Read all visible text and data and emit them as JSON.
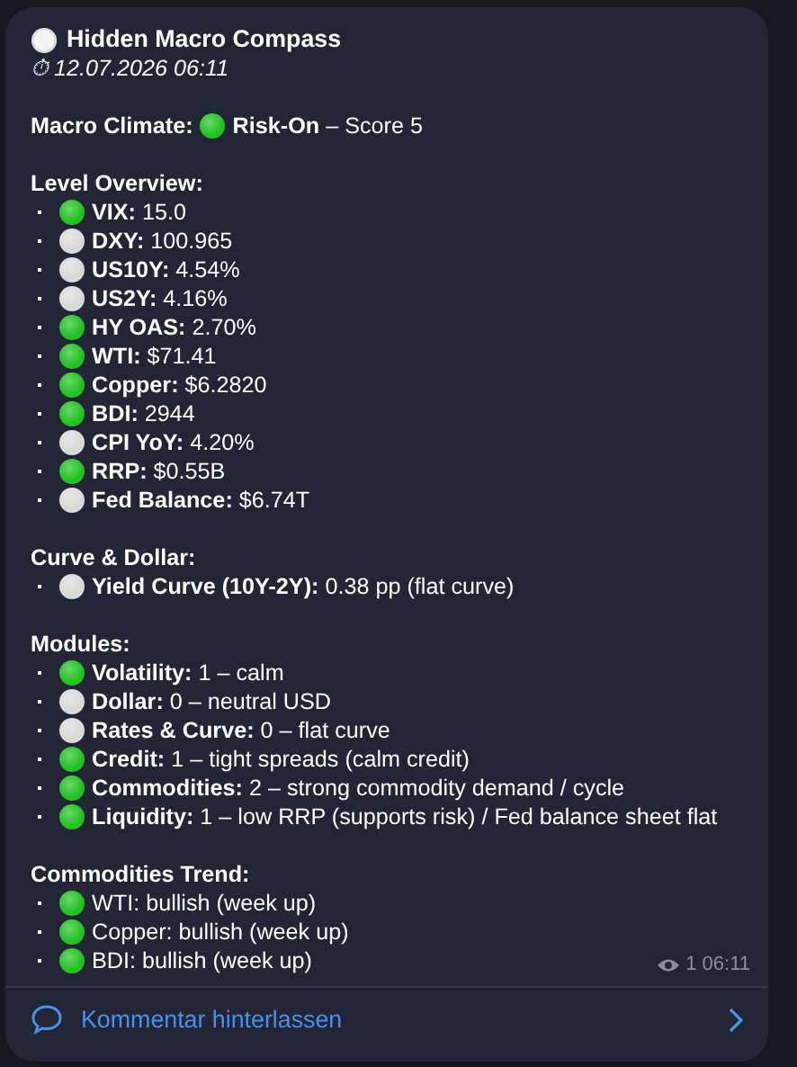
{
  "message": {
    "title": "Hidden Macro Compass",
    "timestamp_icon": "⏱",
    "timestamp": "12.07.2026 06:11",
    "climate": {
      "label": "Macro Climate:",
      "color": "#1fc21f",
      "status": "Risk-On",
      "score": "– Score 5"
    },
    "sections": [
      {
        "heading": "Level Overview:",
        "items": [
          {
            "color": "#1fc21f",
            "label": "VIX:",
            "value": "15.0"
          },
          {
            "color": "#d9d9d9",
            "label": "DXY:",
            "value": "100.965"
          },
          {
            "color": "#d9d9d9",
            "label": "US10Y:",
            "value": "4.54%"
          },
          {
            "color": "#d9d9d9",
            "label": "US2Y:",
            "value": "4.16%"
          },
          {
            "color": "#1fc21f",
            "label": "HY OAS:",
            "value": "2.70%"
          },
          {
            "color": "#1fc21f",
            "label": "WTI:",
            "value": "$71.41"
          },
          {
            "color": "#1fc21f",
            "label": "Copper:",
            "value": "$6.2820"
          },
          {
            "color": "#1fc21f",
            "label": "BDI:",
            "value": "2944"
          },
          {
            "color": "#d9d9d9",
            "label": "CPI YoY:",
            "value": "4.20%"
          },
          {
            "color": "#1fc21f",
            "label": "RRP:",
            "value": "$0.55B"
          },
          {
            "color": "#d9d9d9",
            "label": "Fed Balance:",
            "value": "$6.74T"
          }
        ]
      },
      {
        "heading": "Curve & Dollar:",
        "items": [
          {
            "color": "#d9d9d9",
            "label": "Yield Curve (10Y-2Y):",
            "value": "0.38 pp (flat curve)"
          }
        ]
      },
      {
        "heading": "Modules:",
        "items": [
          {
            "color": "#1fc21f",
            "label": "Volatility:",
            "value": "1 – calm"
          },
          {
            "color": "#d9d9d9",
            "label": "Dollar:",
            "value": "0 – neutral USD"
          },
          {
            "color": "#d9d9d9",
            "label": "Rates & Curve:",
            "value": "0 – flat curve"
          },
          {
            "color": "#1fc21f",
            "label": "Credit:",
            "value": "1 – tight spreads (calm credit)"
          },
          {
            "color": "#1fc21f",
            "label": "Commodities:",
            "value": "2 – strong commodity demand / cycle"
          },
          {
            "color": "#1fc21f",
            "label": "Liquidity:",
            "value": "1 – low RRP (supports risk) / Fed balance sheet flat"
          }
        ]
      },
      {
        "heading": "Commodities Trend:",
        "items": [
          {
            "color": "#1fc21f",
            "value": "WTI: bullish (week up)"
          },
          {
            "color": "#1fc21f",
            "value": "Copper: bullish (week up)"
          },
          {
            "color": "#1fc21f",
            "value": "BDI: bullish (week up)"
          }
        ]
      }
    ],
    "views": "1",
    "time": "06:11"
  },
  "comment_link": {
    "label": "Kommentar hinterlassen"
  }
}
